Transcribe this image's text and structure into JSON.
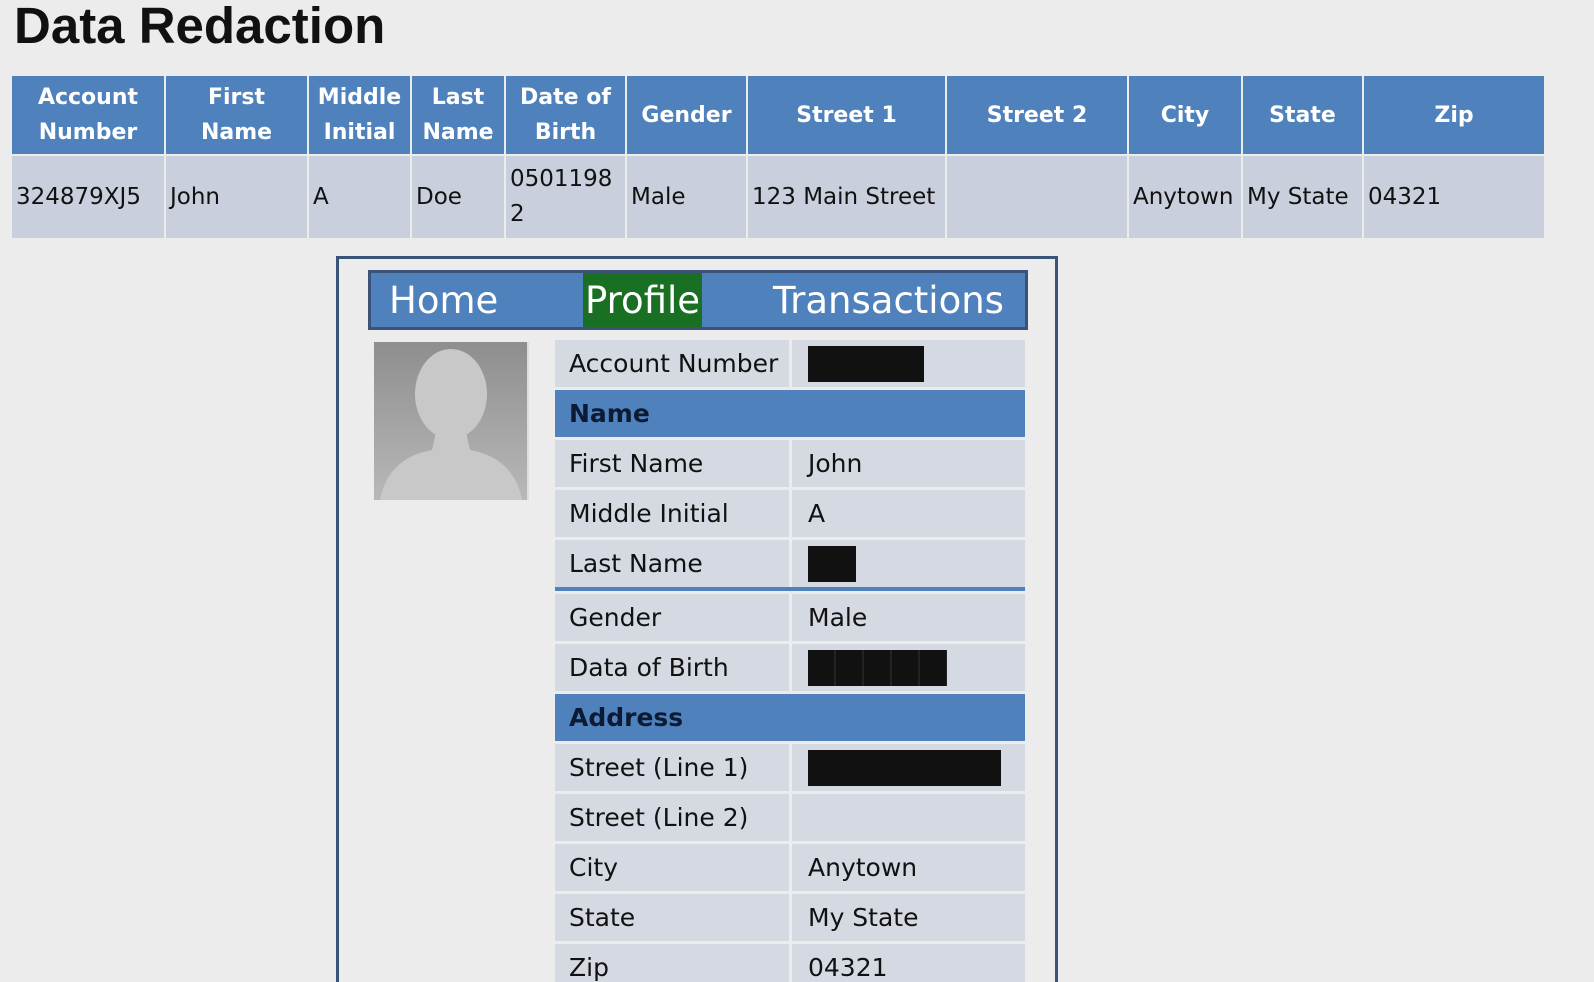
{
  "page": {
    "title": "Data Redaction"
  },
  "source_table": {
    "headers": [
      "Account Number",
      "First Name",
      "Middle Initial",
      "Last Name",
      "Date of Birth",
      "Gender",
      "Street 1",
      "Street 2",
      "City",
      "State",
      "Zip"
    ],
    "row": [
      "324879XJ5",
      "John",
      "A",
      "Doe",
      "05011982",
      "Male",
      "123 Main Street",
      "",
      "Anytown",
      "My State",
      "04321"
    ]
  },
  "profile_view": {
    "nav": {
      "home": "Home",
      "profile": "Profile",
      "transactions": "Transactions",
      "active_tab": "Profile",
      "active_color": "#1a7022"
    },
    "avatar_icon": "person-silhouette-icon",
    "rows": {
      "account_number": {
        "label": "Account Number",
        "value": "",
        "redacted": true
      },
      "name_section": "Name",
      "first_name": {
        "label": "First Name",
        "value": "John"
      },
      "middle_initial": {
        "label": "Middle Initial",
        "value": "A"
      },
      "last_name": {
        "label": "Last Name",
        "value": "",
        "redacted": true
      },
      "gender": {
        "label": "Gender",
        "value": "Male"
      },
      "dob": {
        "label": "Data of Birth",
        "value": "",
        "redacted": true
      },
      "address_section": "Address",
      "street1": {
        "label": "Street (Line 1)",
        "value": "",
        "redacted": true
      },
      "street2": {
        "label": "Street (Line 2)",
        "value": ""
      },
      "city": {
        "label": "City",
        "value": "Anytown"
      },
      "state": {
        "label": "State",
        "value": "My State"
      },
      "zip": {
        "label": "Zip",
        "value": "04321"
      }
    }
  },
  "colors": {
    "header_blue": "#4f81bd",
    "redaction": "#111111"
  }
}
